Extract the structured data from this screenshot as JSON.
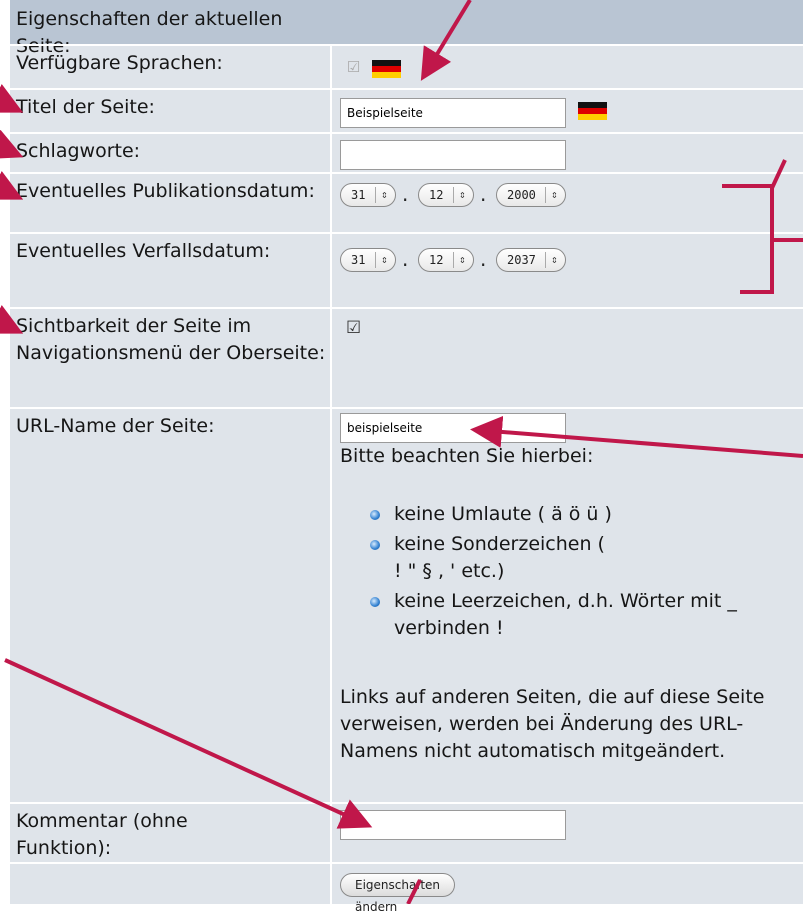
{
  "header": {
    "title": "Eigenschaften der aktuellen Seite:"
  },
  "rows": {
    "sprachen": {
      "label": "Verfügbare Sprachen:"
    },
    "titel": {
      "label": "Titel der Seite:",
      "value": "Beispielseite"
    },
    "schlagworte": {
      "label": "Schlagworte:",
      "value": ""
    },
    "publikation": {
      "label": "Eventuelles Publikationsdatum:",
      "day": "31",
      "month": "12",
      "year": "2000"
    },
    "verfall": {
      "label": "Eventuelles Verfallsdatum:",
      "day": "31",
      "month": "12",
      "year": "2037"
    },
    "sichtbarkeit": {
      "label": "Sichtbarkeit der Seite im Navigationsmenü der Oberseite:",
      "checked": true
    },
    "url": {
      "label": "URL-Name der Seite:",
      "value": "beispielseite",
      "hint_title": "Bitte beachten Sie hierbei:",
      "bullets": [
        "keine Umlaute ( ä ö ü )",
        "keine Sonderzeichen ( ! \" § , ' etc.)",
        "keine Leerzeichen, d.h. Wörter mit _ verbinden !"
      ],
      "note": "Links auf anderen Seiten, die auf diese Seite verweisen, werden bei Änderung des URL-Namens nicht automatisch mitgeändert."
    },
    "kommentar": {
      "label": "Kommentar (ohne Funktion):",
      "value": ""
    }
  },
  "submit": {
    "label": "Eigenschaften ändern"
  },
  "colors": {
    "annotation": "#c0174a",
    "header_bg": "#b9c5d3",
    "row_bg": "#dfe4ea"
  },
  "icons": {
    "flag": "german-flag-icon",
    "checkbox": "checkbox-icon"
  }
}
